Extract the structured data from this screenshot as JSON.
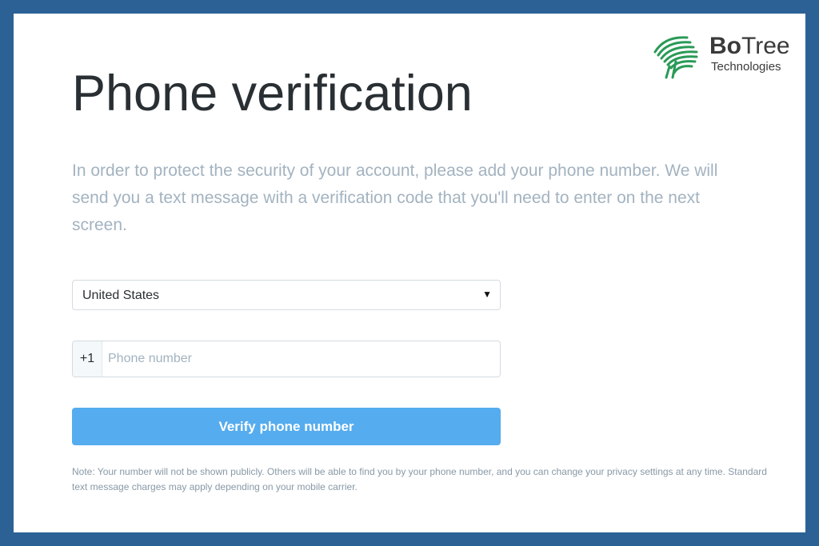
{
  "brand": {
    "name_bold": "Bo",
    "name_light": "Tree",
    "subtitle": "Technologies",
    "color": "#2a9a57",
    "icon": "botree-leaf-logo"
  },
  "page": {
    "title": "Phone verification",
    "intro": "In order to protect the security of your account, please add your phone number. We will send you a text message with a verification code that you'll need to enter on the next screen."
  },
  "form": {
    "country": {
      "selected": "United States",
      "caret_icon": "caret-down-icon"
    },
    "phone": {
      "prefix": "+1",
      "placeholder": "Phone number",
      "value": ""
    },
    "submit_label": "Verify phone number",
    "note": "Note: Your number will not be shown publicly. Others will be able to find you by your phone number, and you can change your privacy settings at any time. Standard text message charges may apply depending on your mobile carrier."
  },
  "colors": {
    "frame": "#2c6196",
    "accent_button": "#55acee",
    "muted_text": "#a3b3c0",
    "title_text": "#292f33"
  }
}
